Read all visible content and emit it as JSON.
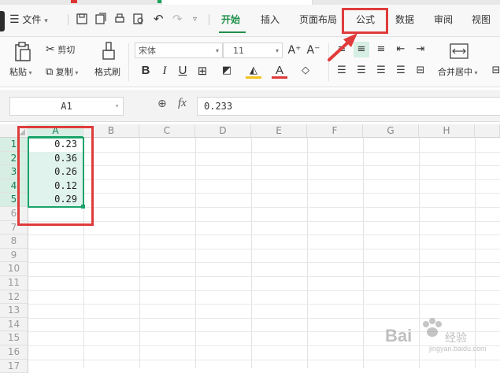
{
  "menu": {
    "file": "文件",
    "tabs": [
      "开始",
      "插入",
      "页面布局",
      "公式",
      "数据",
      "审阅",
      "视图"
    ],
    "active_tab": "开始",
    "highlighted_tab": "公式"
  },
  "ribbon": {
    "paste": "粘贴",
    "cut": "剪切",
    "copy": "复制",
    "format_painter": "格式刷",
    "font_name": "宋体",
    "font_size": "11",
    "merge_center": "合并居中"
  },
  "formula_bar": {
    "cell_ref": "A1",
    "fx_label": "fx",
    "value": "0.233"
  },
  "sheet": {
    "columns": [
      "A",
      "B",
      "C",
      "D",
      "E",
      "F",
      "G",
      "H"
    ],
    "rows": [
      "1",
      "2",
      "3",
      "4",
      "5",
      "6",
      "7",
      "8",
      "9",
      "10",
      "11",
      "12",
      "13",
      "14",
      "15",
      "16",
      "17"
    ],
    "column_a_values": [
      "0.23",
      "0.36",
      "0.26",
      "0.12",
      "0.29"
    ]
  },
  "colors": {
    "accent_green": "#1f8f4a",
    "annotation_red": "#e03b3b",
    "selection_green": "#1aa36a"
  }
}
